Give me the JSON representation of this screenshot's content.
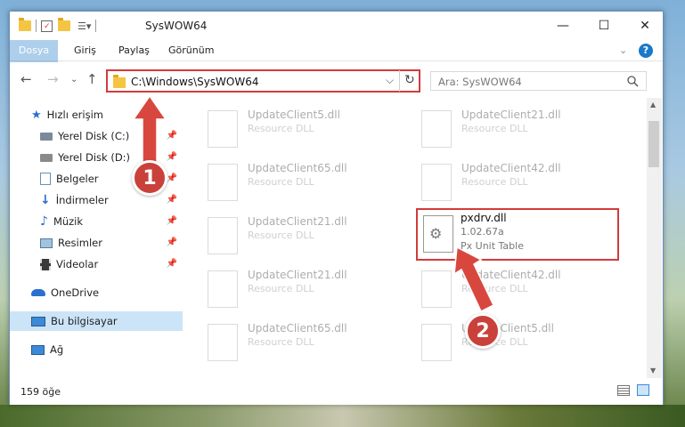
{
  "window": {
    "title": "SysWOW64",
    "minimize": "—",
    "maximize": "☐",
    "close": "✕"
  },
  "ribbon": {
    "tabs": [
      {
        "label": "Dosya"
      },
      {
        "label": "Giriş"
      },
      {
        "label": "Paylaş"
      },
      {
        "label": "Görünüm"
      }
    ],
    "help": "?"
  },
  "address": {
    "path": "C:\\Windows\\SysWOW64",
    "refresh": "↻",
    "dropdown": "⌵"
  },
  "search": {
    "placeholder": "Ara: SysWOW64",
    "icon": "search-icon"
  },
  "sidebar": {
    "items": [
      {
        "label": "Hızlı erişim",
        "icon": "star-icon"
      },
      {
        "label": "Yerel Disk (C:)",
        "icon": "drive-icon"
      },
      {
        "label": "Yerel Disk (D:)",
        "icon": "drive-icon"
      },
      {
        "label": "Belgeler",
        "icon": "documents-icon"
      },
      {
        "label": "İndirmeler",
        "icon": "download-icon"
      },
      {
        "label": "Müzik",
        "icon": "music-icon"
      },
      {
        "label": "Resimler",
        "icon": "pictures-icon"
      },
      {
        "label": "Videolar",
        "icon": "video-icon"
      },
      {
        "label": "OneDrive",
        "icon": "cloud-icon"
      },
      {
        "label": "Bu bilgisayar",
        "icon": "computer-icon"
      },
      {
        "label": "Ağ",
        "icon": "network-icon"
      }
    ]
  },
  "files": [
    {
      "name": "UpdateClient5.dll",
      "desc": "Resource DLL"
    },
    {
      "name": "UpdateClient21.dll",
      "desc": "Resource DLL"
    },
    {
      "name": "UpdateClient65.dll",
      "desc": "Resource DLL"
    },
    {
      "name": "UpdateClient42.dll",
      "desc": "Resource DLL"
    },
    {
      "name": "UpdateClient21.dll",
      "desc": "Resource DLL"
    },
    {
      "name": "UpdateClient21.dll",
      "desc": "Resource DLL"
    },
    {
      "name": "UpdateClient42.dll",
      "desc": "Resource DLL"
    },
    {
      "name": "UpdateClient65.dll",
      "desc": "Resource DLL"
    },
    {
      "name": "UpdateClient5.dll",
      "desc": "Resource DLL"
    }
  ],
  "highlighted_file": {
    "name": "pxdrv.dll",
    "version": "1.02.67a",
    "desc": "Px Unit Table"
  },
  "status": {
    "count": "159 öğe"
  },
  "annotations": [
    {
      "number": "1"
    },
    {
      "number": "2"
    }
  ],
  "colors": {
    "accent": "#1979ca",
    "annotation": "#c9413a",
    "selection": "#cce4f7"
  }
}
